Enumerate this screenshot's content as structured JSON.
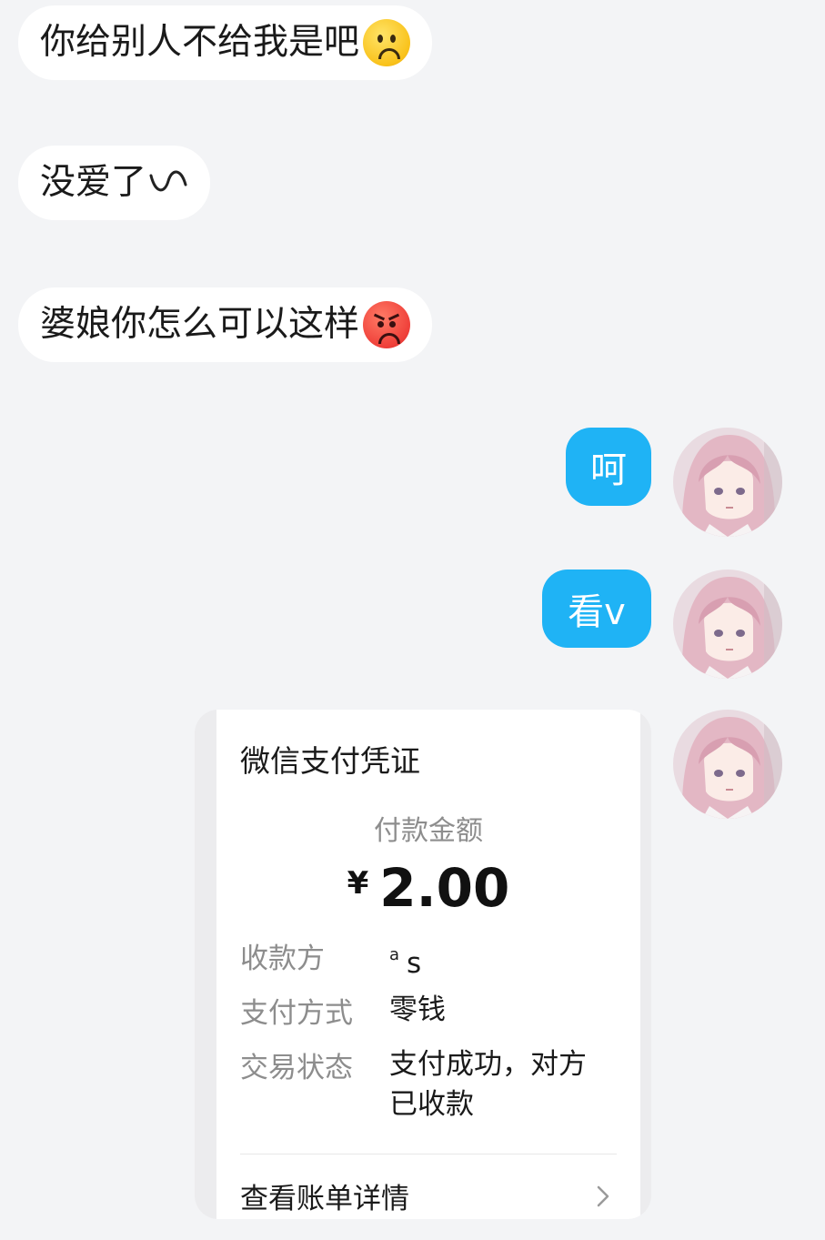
{
  "messages_incoming": [
    {
      "text": "你给别人不给我是吧",
      "emoji": "frowning-face-emoji"
    },
    {
      "text": "没爱了",
      "emoji": "wavy-dash"
    },
    {
      "text": "婆娘你怎么可以这样",
      "emoji": "angry-face-emoji"
    }
  ],
  "messages_outgoing": [
    {
      "text": "呵"
    },
    {
      "text": "看v"
    }
  ],
  "payment_card": {
    "title": "微信支付凭证",
    "amount_label": "付款金额",
    "currency": "¥",
    "amount": "2.00",
    "payee_label": "收款方",
    "payee_super": "a",
    "payee_value": "s",
    "method_label": "支付方式",
    "method_value": "零钱",
    "status_label": "交易状态",
    "status_value": "支付成功，对方已收款",
    "detail_link": "查看账单详情"
  },
  "colors": {
    "background": "#f3f4f6",
    "incoming_bubble": "#ffffff",
    "outgoing_bubble": "#1fb3f5",
    "muted_text": "#8d8d8d"
  }
}
